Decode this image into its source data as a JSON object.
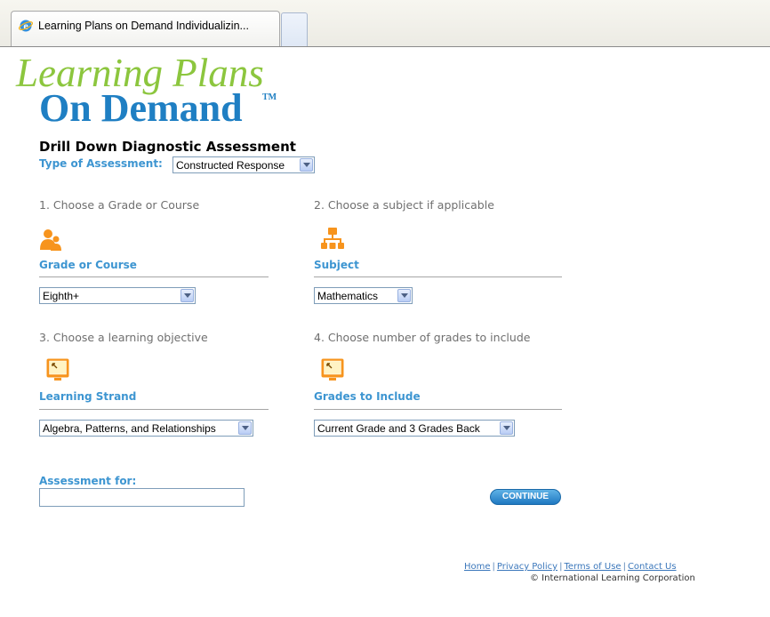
{
  "browser": {
    "tab_title": "Learning Plans on Demand Individualizin..."
  },
  "logo": {
    "line1": "Learning Plans",
    "line2": "On Demand",
    "tm": "TM"
  },
  "page": {
    "title": "Drill Down Diagnostic Assessment",
    "type_label": "Type of Assessment:",
    "type_value": "Constructed Response"
  },
  "steps": {
    "grade": {
      "instruction": "1. Choose a Grade or Course",
      "label": "Grade or Course",
      "value": "Eighth+",
      "icon": "people-icon"
    },
    "subject": {
      "instruction": "2. Choose a subject if applicable",
      "label": "Subject",
      "value": "Mathematics",
      "icon": "hierarchy-icon"
    },
    "strand": {
      "instruction": "3. Choose a learning objective",
      "label": "Learning Strand",
      "value": "Algebra, Patterns, and Relationships",
      "icon": "monitor-icon"
    },
    "grades_include": {
      "instruction": "4. Choose number of grades to include",
      "label": "Grades to Include",
      "value": "Current Grade and 3 Grades Back",
      "icon": "monitor-icon"
    }
  },
  "assessment_for": {
    "label": "Assessment for:",
    "value": ""
  },
  "continue_label": "CONTINUE",
  "footer": {
    "links": [
      "Home",
      "Privacy Policy",
      "Terms of Use",
      "Contact Us"
    ],
    "copyright": "© International Learning Corporation"
  },
  "colors": {
    "accent_blue": "#3d95d1",
    "logo_green": "#8cc63e",
    "logo_blue": "#1f7fc3",
    "icon_orange": "#f7941d"
  }
}
